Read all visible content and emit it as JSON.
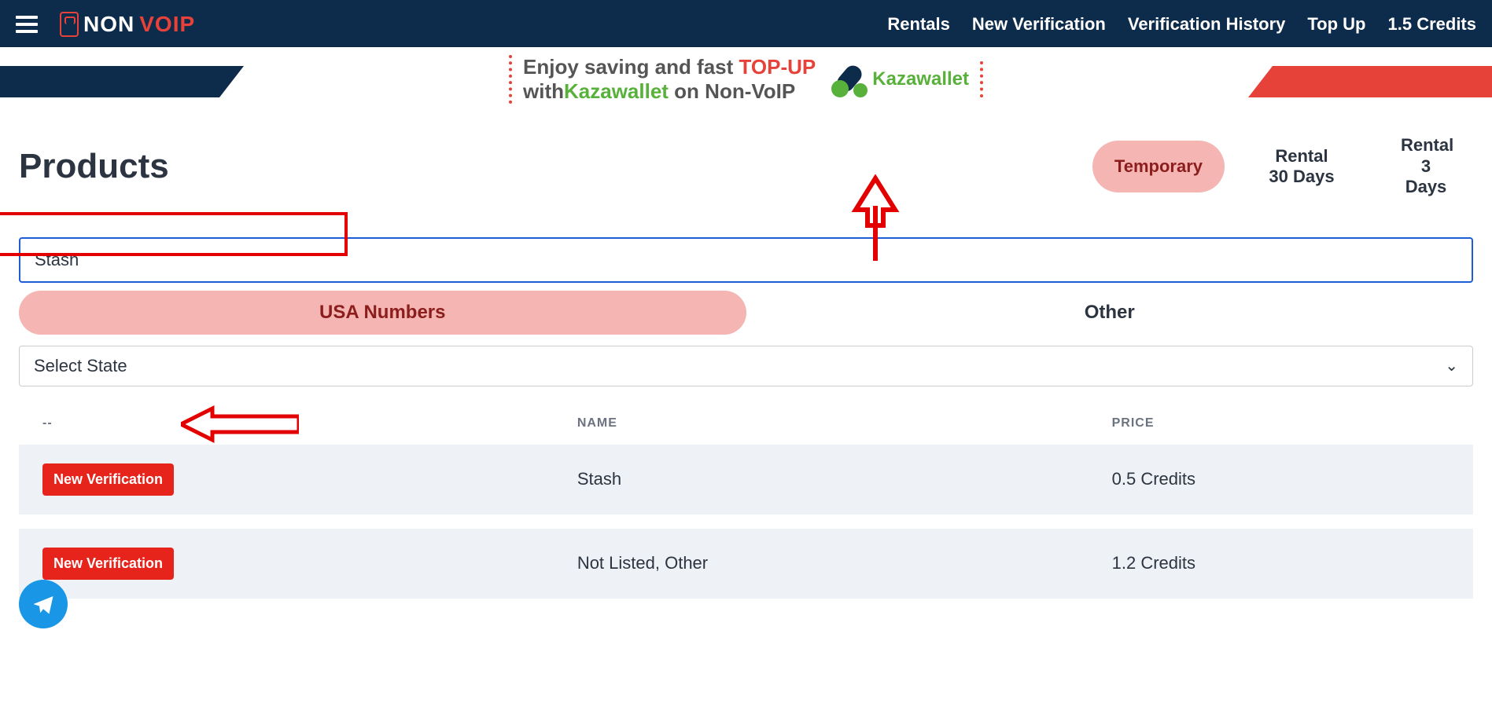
{
  "header": {
    "logo_text1": "NON",
    "logo_text2": "VOIP",
    "nav": {
      "rentals": "Rentals",
      "new_verification": "New Verification",
      "verification_history": "Verification History",
      "top_up": "Top Up",
      "credits": "1.5 Credits"
    }
  },
  "promo": {
    "line1a": "Enjoy saving and fast ",
    "line1b": "TOP-UP",
    "line2a": "with",
    "line2b": "Kazawallet",
    "line2c": " on Non-VoIP",
    "kaza_brand": "Kazawallet"
  },
  "page": {
    "title": "Products",
    "tabs": {
      "temporary": "Temporary",
      "rental30": "Rental 30 Days",
      "rental3": "Rental 3 Days"
    },
    "search_value": "Stash",
    "number_tabs": {
      "usa": "USA Numbers",
      "other": "Other"
    },
    "state_placeholder": "Select State",
    "table": {
      "headers": {
        "c1": "--",
        "c2": "NAME",
        "c3": "PRICE"
      },
      "rows": [
        {
          "action": "New Verification",
          "name": "Stash",
          "price": "0.5 Credits"
        },
        {
          "action": "New Verification",
          "name": "Not Listed, Other",
          "price": "1.2 Credits"
        }
      ]
    }
  },
  "icons": {
    "chevron_down": "⌄"
  }
}
